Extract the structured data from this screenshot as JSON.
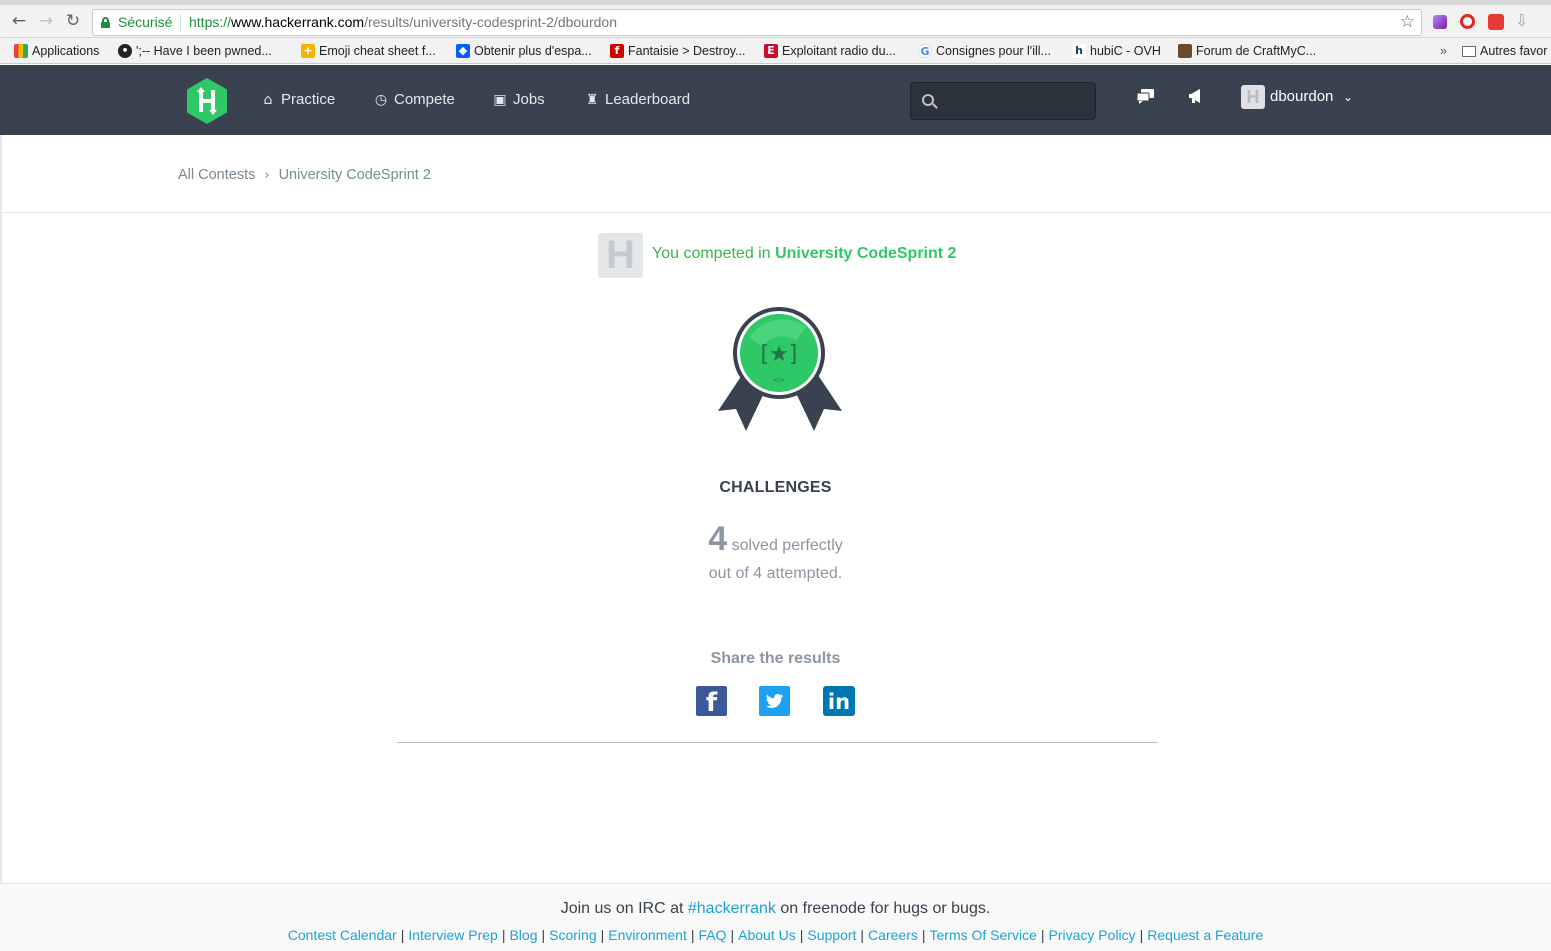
{
  "browser": {
    "secure_label": "Sécurisé",
    "url_scheme": "https://",
    "url_host": "www.hackerrank.com",
    "url_path": "/results/university-codesprint-2/dbourdon",
    "bookmarks": [
      {
        "label": "Applications",
        "icon": "apps-grid-icon",
        "color": "#e94235"
      },
      {
        "label": "';-- Have I been pwned...",
        "icon": "lock-icon",
        "color": "#222222"
      },
      {
        "label": "Emoji cheat sheet f...",
        "icon": "thumbs-up-icon",
        "color": "#f4b400"
      },
      {
        "label": "Obtenir plus d'espa...",
        "icon": "dropbox-icon",
        "color": "#0061fe"
      },
      {
        "label": "Fantaisie > Destroy...",
        "icon": "fantaisie-icon",
        "color": "#d10000"
      },
      {
        "label": "Exploitant radio du...",
        "icon": "eu-icon",
        "color": "#c8102e"
      },
      {
        "label": "Consignes pour l'ill...",
        "icon": "google-icon",
        "color": "#4285f4"
      },
      {
        "label": "hubiC - OVH",
        "icon": "hubic-icon",
        "color": "#123f6d"
      },
      {
        "label": "Forum de CraftMyC...",
        "icon": "craft-icon",
        "color": "#6b4a2b"
      }
    ],
    "other_bookmarks": "Autres favor",
    "overflow": "»"
  },
  "header": {
    "nav": [
      {
        "label": "Practice",
        "icon": "home-icon"
      },
      {
        "label": "Compete",
        "icon": "clock-icon"
      },
      {
        "label": "Jobs",
        "icon": "briefcase-icon"
      },
      {
        "label": "Leaderboard",
        "icon": "trophy-icon"
      }
    ],
    "search_placeholder": "",
    "username": "dbourdon",
    "colors": {
      "bg": "#39424e",
      "logo": "#2ec866"
    }
  },
  "breadcrumb": {
    "parent": "All Contests",
    "current": "University CodeSprint 2"
  },
  "result": {
    "competed_prefix": "You competed in",
    "contest_name": "University CodeSprint 2",
    "section_title": "CHALLENGES",
    "solved_count": "4",
    "solved_suffix": "solved perfectly",
    "attempted_text": "out of 4 attempted.",
    "share_title": "Share the results"
  },
  "footer": {
    "irc_prefix": "Join us on IRC at",
    "irc_channel": "#hackerrank",
    "irc_suffix": "on freenode for hugs or bugs.",
    "links": [
      "Contest Calendar",
      "Interview Prep",
      "Blog",
      "Scoring",
      "Environment",
      "FAQ",
      "About Us",
      "Support",
      "Careers",
      "Terms Of Service",
      "Privacy Policy",
      "Request a Feature"
    ]
  }
}
